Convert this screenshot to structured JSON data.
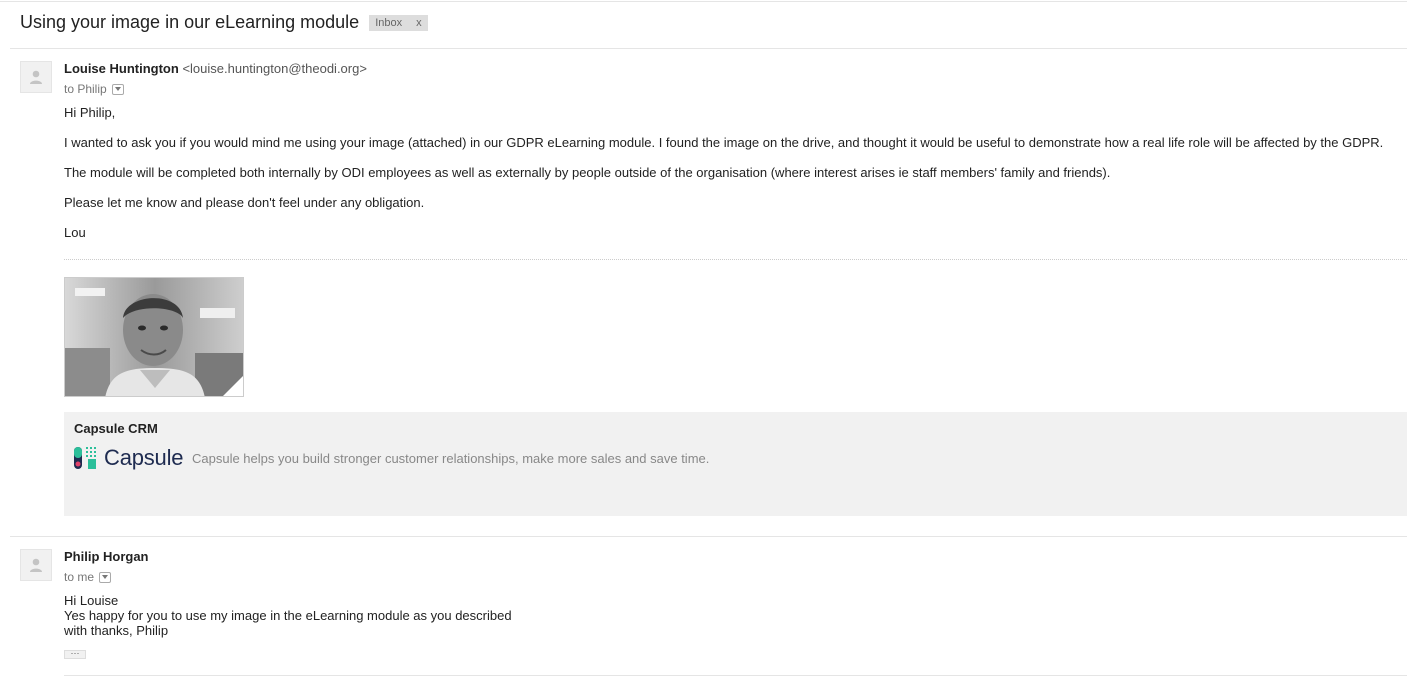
{
  "thread": {
    "subject": "Using your image in our eLearning module",
    "label": "Inbox",
    "label_remove": "x"
  },
  "message1": {
    "sender_name": "Louise Huntington",
    "sender_email": "<louise.huntington@theodi.org>",
    "to": "to Philip",
    "paragraphs": [
      "Hi Philip,",
      "I wanted to ask you if you would mind me using your image (attached) in our GDPR eLearning module. I found the image on the drive, and thought it would be useful to demonstrate how a real life role will be affected by the GDPR.",
      "The module will be completed both internally by ODI employees as well as externally by people outside of the organisation (where interest arises ie staff members' family and friends).",
      "Please let me know and please don't feel under any obligation.",
      "Lou"
    ],
    "link_card": {
      "title": "Capsule CRM",
      "logo_text": "Capsule",
      "description": "Capsule helps you build stronger customer relationships, make more sales and save time."
    }
  },
  "message2": {
    "sender_name": "Philip Horgan",
    "to": "to me",
    "lines": [
      "Hi Louise",
      "Yes happy for you to use my image in the eLearning module as you described",
      "with thanks, Philip"
    ],
    "trimmed": "···"
  },
  "colors": {
    "capsule_pink": "#e0416a",
    "capsule_teal": "#2bbf9a",
    "capsule_navy": "#1e2b50"
  }
}
